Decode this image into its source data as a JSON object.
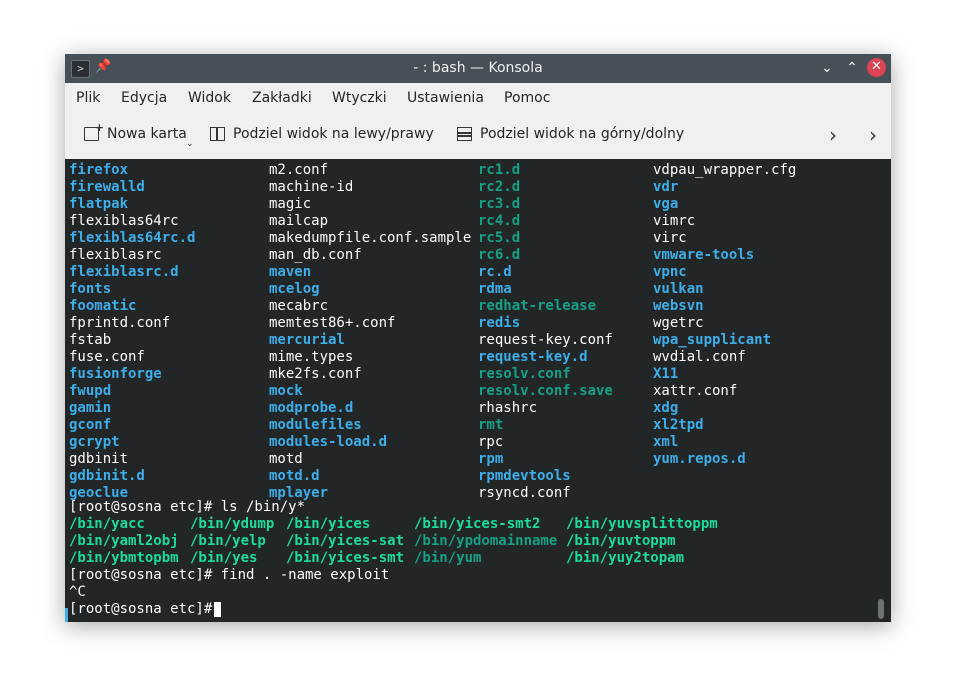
{
  "window": {
    "title": "- : bash — Konsola",
    "minimize_glyph": "⌄",
    "maximize_glyph": "⌃",
    "close_glyph": "✕",
    "app_icon_glyph": ">",
    "pin_glyph": "📌"
  },
  "menu": [
    "Plik",
    "Edycja",
    "Widok",
    "Zakładki",
    "Wtyczki",
    "Ustawienia",
    "Pomoc"
  ],
  "toolbar": {
    "new_tab": "Nowa karta",
    "split_lr": "Podziel widok na lewy/prawy",
    "split_tb": "Podziel widok na górny/dolny",
    "dropdown_glyph": "⌄",
    "more_glyph": "›"
  },
  "colors": {
    "directory": "#3daee9",
    "symlink": "#16a085",
    "executable": "#1cdc9a",
    "file": "#fcfcfc",
    "background": "#232627"
  },
  "terminal": {
    "listing": [
      [
        {
          "t": "firefox",
          "k": "dir"
        },
        {
          "t": "m2.conf",
          "k": "file"
        },
        {
          "t": "rc1.d",
          "k": "link"
        },
        {
          "t": "vdpau_wrapper.cfg",
          "k": "file"
        }
      ],
      [
        {
          "t": "firewalld",
          "k": "dir"
        },
        {
          "t": "machine-id",
          "k": "file"
        },
        {
          "t": "rc2.d",
          "k": "link"
        },
        {
          "t": "vdr",
          "k": "dir"
        }
      ],
      [
        {
          "t": "flatpak",
          "k": "dir"
        },
        {
          "t": "magic",
          "k": "file"
        },
        {
          "t": "rc3.d",
          "k": "link"
        },
        {
          "t": "vga",
          "k": "dir"
        }
      ],
      [
        {
          "t": "flexiblas64rc",
          "k": "file"
        },
        {
          "t": "mailcap",
          "k": "file"
        },
        {
          "t": "rc4.d",
          "k": "link"
        },
        {
          "t": "vimrc",
          "k": "file"
        }
      ],
      [
        {
          "t": "flexiblas64rc.d",
          "k": "dir"
        },
        {
          "t": "makedumpfile.conf.sample",
          "k": "file"
        },
        {
          "t": "rc5.d",
          "k": "link"
        },
        {
          "t": "virc",
          "k": "file"
        }
      ],
      [
        {
          "t": "flexiblasrc",
          "k": "file"
        },
        {
          "t": "man_db.conf",
          "k": "file"
        },
        {
          "t": "rc6.d",
          "k": "link"
        },
        {
          "t": "vmware-tools",
          "k": "dir"
        }
      ],
      [
        {
          "t": "flexiblasrc.d",
          "k": "dir"
        },
        {
          "t": "maven",
          "k": "dir"
        },
        {
          "t": "rc.d",
          "k": "dir"
        },
        {
          "t": "vpnc",
          "k": "dir"
        }
      ],
      [
        {
          "t": "fonts",
          "k": "dir"
        },
        {
          "t": "mcelog",
          "k": "dir"
        },
        {
          "t": "rdma",
          "k": "dir"
        },
        {
          "t": "vulkan",
          "k": "dir"
        }
      ],
      [
        {
          "t": "foomatic",
          "k": "dir"
        },
        {
          "t": "mecabrc",
          "k": "file"
        },
        {
          "t": "redhat-release",
          "k": "link"
        },
        {
          "t": "websvn",
          "k": "dir"
        }
      ],
      [
        {
          "t": "fprintd.conf",
          "k": "file"
        },
        {
          "t": "memtest86+.conf",
          "k": "file"
        },
        {
          "t": "redis",
          "k": "dir"
        },
        {
          "t": "wgetrc",
          "k": "file"
        }
      ],
      [
        {
          "t": "fstab",
          "k": "file"
        },
        {
          "t": "mercurial",
          "k": "dir"
        },
        {
          "t": "request-key.conf",
          "k": "file"
        },
        {
          "t": "wpa_supplicant",
          "k": "dir"
        }
      ],
      [
        {
          "t": "fuse.conf",
          "k": "file"
        },
        {
          "t": "mime.types",
          "k": "file"
        },
        {
          "t": "request-key.d",
          "k": "dir"
        },
        {
          "t": "wvdial.conf",
          "k": "file"
        }
      ],
      [
        {
          "t": "fusionforge",
          "k": "dir"
        },
        {
          "t": "mke2fs.conf",
          "k": "file"
        },
        {
          "t": "resolv.conf",
          "k": "link"
        },
        {
          "t": "X11",
          "k": "dir"
        }
      ],
      [
        {
          "t": "fwupd",
          "k": "dir"
        },
        {
          "t": "mock",
          "k": "dir"
        },
        {
          "t": "resolv.conf.save",
          "k": "link"
        },
        {
          "t": "xattr.conf",
          "k": "file"
        }
      ],
      [
        {
          "t": "gamin",
          "k": "dir"
        },
        {
          "t": "modprobe.d",
          "k": "dir"
        },
        {
          "t": "rhashrc",
          "k": "file"
        },
        {
          "t": "xdg",
          "k": "dir"
        }
      ],
      [
        {
          "t": "gconf",
          "k": "dir"
        },
        {
          "t": "modulefiles",
          "k": "dir"
        },
        {
          "t": "rmt",
          "k": "link"
        },
        {
          "t": "xl2tpd",
          "k": "dir"
        }
      ],
      [
        {
          "t": "gcrypt",
          "k": "dir"
        },
        {
          "t": "modules-load.d",
          "k": "dir"
        },
        {
          "t": "rpc",
          "k": "file"
        },
        {
          "t": "xml",
          "k": "dir"
        }
      ],
      [
        {
          "t": "gdbinit",
          "k": "file"
        },
        {
          "t": "motd",
          "k": "file"
        },
        {
          "t": "rpm",
          "k": "dir"
        },
        {
          "t": "yum.repos.d",
          "k": "dir"
        }
      ],
      [
        {
          "t": "gdbinit.d",
          "k": "dir"
        },
        {
          "t": "motd.d",
          "k": "dir"
        },
        {
          "t": "rpmdevtools",
          "k": "dir"
        },
        {
          "t": "",
          "k": "file"
        }
      ],
      [
        {
          "t": "geoclue",
          "k": "dir"
        },
        {
          "t": "mplayer",
          "k": "dir"
        },
        {
          "t": "rsyncd.conf",
          "k": "file"
        },
        {
          "t": "",
          "k": "file"
        }
      ]
    ],
    "ls_prompt": "[root@sosna etc]# ls /bin/y*",
    "bin_listing": [
      [
        {
          "t": "/bin/yacc",
          "k": "exec"
        },
        {
          "t": "/bin/ydump",
          "k": "exec"
        },
        {
          "t": "/bin/yices",
          "k": "exec"
        },
        {
          "t": "/bin/yices-smt2",
          "k": "exec"
        },
        {
          "t": "/bin/yuvsplittoppm",
          "k": "exec"
        }
      ],
      [
        {
          "t": "/bin/yaml2obj",
          "k": "exec"
        },
        {
          "t": "/bin/yelp",
          "k": "exec"
        },
        {
          "t": "/bin/yices-sat",
          "k": "exec"
        },
        {
          "t": "/bin/ypdomainname",
          "k": "link"
        },
        {
          "t": "/bin/yuvtoppm",
          "k": "exec"
        }
      ],
      [
        {
          "t": "/bin/ybmtopbm",
          "k": "exec"
        },
        {
          "t": "/bin/yes",
          "k": "exec"
        },
        {
          "t": "/bin/yices-smt",
          "k": "exec"
        },
        {
          "t": "/bin/yum",
          "k": "link"
        },
        {
          "t": "/bin/yuy2topam",
          "k": "exec"
        }
      ]
    ],
    "find_prompt": "[root@sosna etc]# find . -name exploit",
    "interrupt": "^C",
    "final_prompt": "[root@sosna etc]# "
  }
}
